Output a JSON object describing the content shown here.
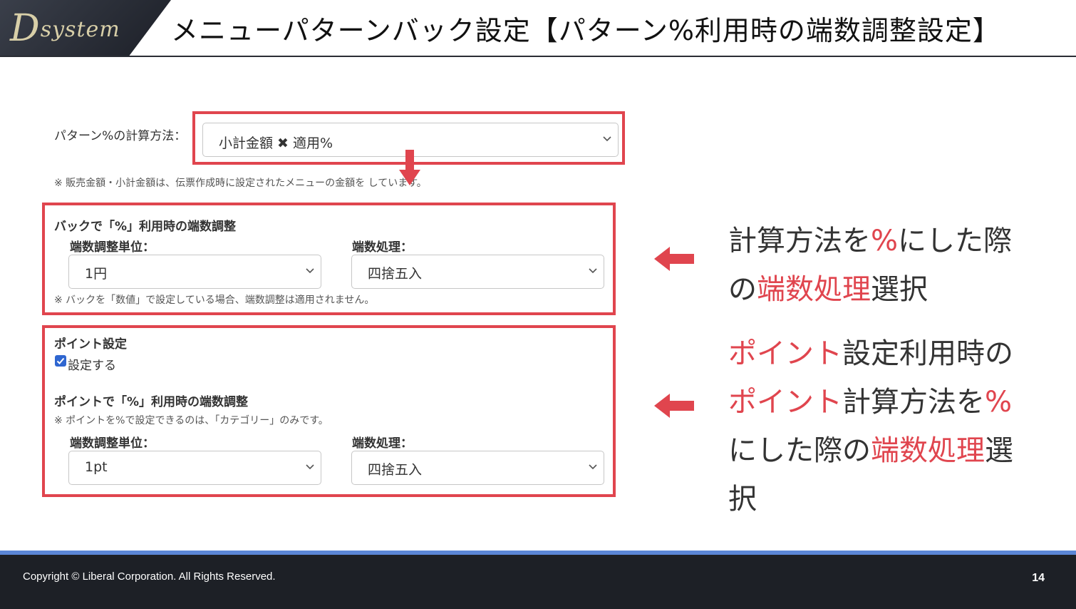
{
  "header": {
    "logo": "Dsystem",
    "title": "メニューパターンバック設定【パターン%利用時の端数調整設定】"
  },
  "form": {
    "calc_method": {
      "label": "パターン%の計算方法：",
      "value": "小計金額 ✖ 適用%",
      "note": "※ 販売金額・小計金額は、伝票作成時に設定されたメニューの金額を      しています。"
    },
    "back_section": {
      "title": "バックで「%」利用時の端数調整",
      "unit_label": "端数調整単位：",
      "unit_value": "1円",
      "rounding_label": "端数処理：",
      "rounding_value": "四捨五入",
      "note": "※ バックを「数値」で設定している場合、端数調整は適用されません。"
    },
    "point_section": {
      "title": "ポイント設定",
      "checkbox_label": "設定する",
      "checkbox_checked": true,
      "sub_title": "ポイントで「%」利用時の端数調整",
      "note": "※ ポイントを%で設定できるのは、「カテゴリー」のみです。",
      "unit_label": "端数調整単位：",
      "unit_value": "1pt",
      "rounding_label": "端数処理：",
      "rounding_value": "四捨五入"
    }
  },
  "annotations": {
    "first": {
      "l1a": "計算方法を",
      "l1b": "%",
      "l1c": "にした際",
      "l2a": "の",
      "l2b": "端数処理",
      "l2c": "選択"
    },
    "second": {
      "l1a": "ポイント",
      "l1b": "設定利用時の",
      "l2a": "ポイント",
      "l2b": "計算方法を",
      "l2c": "%",
      "l3a": "にした際の",
      "l3b": "端数処理",
      "l3c": "選",
      "l4a": "択"
    }
  },
  "footer": {
    "copyright": "Copyright ©  Liberal Corporation. All Rights Reserved.",
    "page": "14"
  },
  "colors": {
    "accent_red": "#e0454e",
    "footer_bg": "#1d2026",
    "footer_stripe": "#5b86d6"
  }
}
